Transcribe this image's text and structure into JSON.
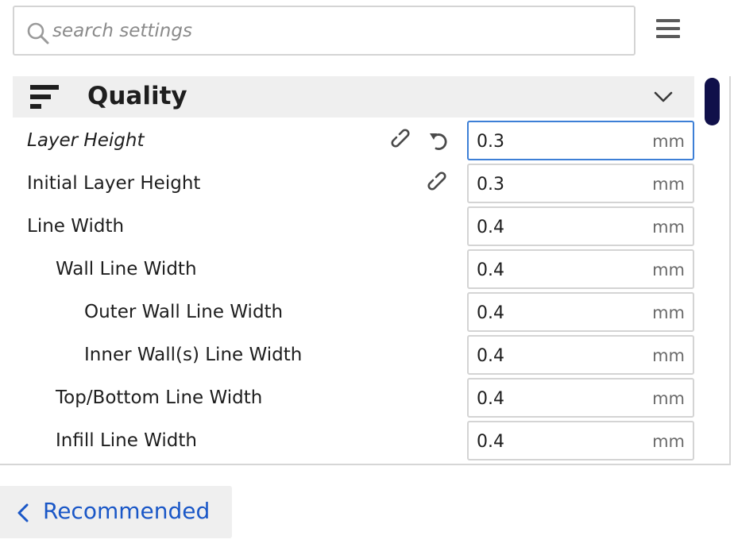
{
  "search": {
    "placeholder": "search settings",
    "value": ""
  },
  "category": {
    "title": "Quality",
    "icon": "quality-bars-icon",
    "expand_icon": "chevron-down-icon"
  },
  "colors": {
    "accent": "#1a57c7",
    "focus_border": "#3d7fd6",
    "scrollbar": "#10104a",
    "category_bg": "#efefef"
  },
  "settings": [
    {
      "label": "Layer Height",
      "value": "0.3",
      "unit": "mm",
      "italic": true,
      "linked": true,
      "resettable": true,
      "focused": true
    },
    {
      "label": "Initial Layer Height",
      "value": "0.3",
      "unit": "mm",
      "linked": true
    },
    {
      "label": "Line Width",
      "value": "0.4",
      "unit": "mm"
    },
    {
      "label": "Wall Line Width",
      "value": "0.4",
      "unit": "mm"
    },
    {
      "label": "Outer Wall Line Width",
      "value": "0.4",
      "unit": "mm"
    },
    {
      "label": "Inner Wall(s) Line Width",
      "value": "0.4",
      "unit": "mm"
    },
    {
      "label": "Top/Bottom Line Width",
      "value": "0.4",
      "unit": "mm"
    },
    {
      "label": "Infill Line Width",
      "value": "0.4",
      "unit": "mm"
    }
  ],
  "footer": {
    "recommended_label": "Recommended"
  }
}
